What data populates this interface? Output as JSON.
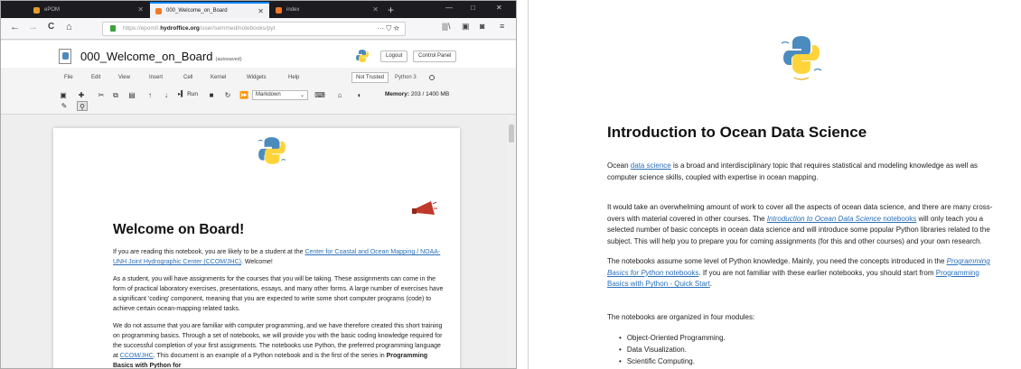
{
  "browser": {
    "tabs": [
      {
        "label": "ePOM",
        "active": false
      },
      {
        "label": "000_Welcome_on_Board",
        "active": true
      },
      {
        "label": "index",
        "active": false
      }
    ],
    "new_tab": "+",
    "window_buttons": [
      "—",
      "□",
      "✕"
    ],
    "nav": {
      "back": "←",
      "forward": "→",
      "reload": "C",
      "home": "⌂"
    },
    "url_prefix": "https://epom0.",
    "url_domain": "hydroffice.org",
    "url_rest": "/user/semmed/notebooks/pyt",
    "url_icons": "··· ⛉ ☆",
    "toolbar_icons": [
      "|||\\",
      "▣",
      "◙",
      "≡"
    ]
  },
  "jupyter": {
    "title": "000_Welcome_on_Board",
    "saved_status": "(autosaved)",
    "logout": "Logout",
    "control_panel": "Control Panel",
    "menus": [
      "File",
      "Edit",
      "View",
      "Insert",
      "Cell",
      "Kernel",
      "Widgets",
      "Help"
    ],
    "not_trusted": "Not Trusted",
    "kernel": "Python 3",
    "run_label": "Run",
    "cell_type": "Markdown",
    "memory_label": "Memory:",
    "memory_value": "203 / 1400 MB"
  },
  "notebook": {
    "heading": "Welcome on Board!",
    "p1_a": "If you are reading this notebook, you are likely to be a student at the ",
    "p1_link": "Center for Coastal and Ocean Mapping / NOAA-UNH Joint Hydrographic Center (CCOM/JHC)",
    "p1_b": ". Welcome!",
    "p2": "As a student, you will have assignments for the courses that you will be taking. These assignments can come in the form of practical laboratory exercises, presentations, essays, and many other forms. A large number of exercises have a significant 'coding' component, meaning that you are expected to write some short computer programs (code) to achieve certain ocean-mapping related tasks.",
    "p3_a": "We do not assume that you are familiar with computer programming, and we have therefore created this short training on programming basics. Through a set of notebooks, we will provide you with the basic coding knowledge required for the successful completion of your first assignments. The notebooks use Python, the preferred programming language at ",
    "p3_link": "CCOM/JHC",
    "p3_b": ". This document is an example of a Python notebook and is the first of the series in ",
    "p3_bold": "Programming Basics with Python for"
  },
  "right": {
    "heading": "Introduction to Ocean Data Science",
    "p1_a": "Ocean ",
    "p1_link": "data science",
    "p1_b": " is a broad and interdisciplinary topic that requires statistical and modeling knowledge as well as computer science skills, coupled with expertise in ocean mapping.",
    "p2_a": "It would take an overwhelming amount of work to cover all the aspects of ocean data science, and there are many cross-overs with material covered in other courses. The ",
    "p2_link_i": "Introduction to Ocean Data Science",
    "p2_link": " notebooks",
    "p2_b": " will only teach you a selected number of basic concepts in ocean data science and will introduce some popular Python libraries related to the subject. This will help you to prepare you for coming assignments (for this and other courses) and your own research.",
    "p3_a": "The notebooks assume some level of Python knowledge. Mainly, you need the concepts introduced in the ",
    "p3_link_i": "Programming Basics for Python",
    "p3_link": " notebooks",
    "p3_b": ". If you are not familiar with these earlier notebooks, you should start from ",
    "p3_link2": "Programming Basics with Python - Quick Start",
    "p3_c": ".",
    "p4": "The notebooks are organized in four modules:",
    "modules": [
      "Object-Oriented Programming.",
      "Data Visualization.",
      "Scientific Computing."
    ]
  },
  "colors": {
    "link": "#2a6fb8",
    "python_blue": "#4b8bbe",
    "python_yellow": "#ffd43b",
    "megaphone": "#c0392b"
  },
  "icons": [
    "python-logo",
    "megaphone-icon",
    "lock-icon"
  ]
}
